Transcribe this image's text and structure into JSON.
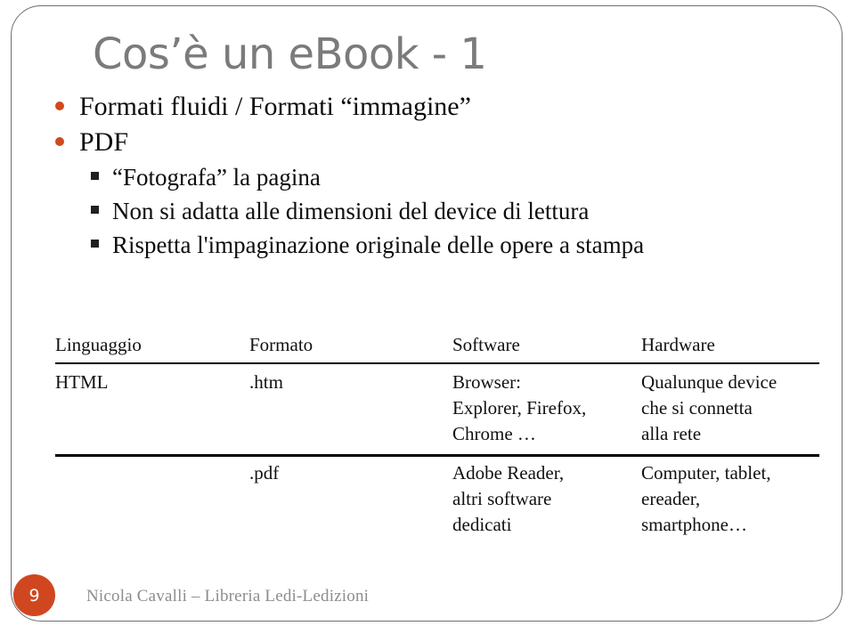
{
  "slide": {
    "title": "Cos’è un eBook - 1",
    "accent_color": "#d0471f",
    "title_color": "#7b7b7b",
    "footer_color": "#8d8d8d",
    "bullets": [
      {
        "level": 1,
        "marker": "dot",
        "text": "Formati fluidi / Formati “immagine”"
      },
      {
        "level": 1,
        "marker": "dot",
        "text": "PDF"
      },
      {
        "level": 2,
        "marker": "square",
        "text": "“Fotografa” la pagina"
      },
      {
        "level": 2,
        "marker": "square",
        "text": "Non si adatta alle dimensioni del device di lettura"
      },
      {
        "level": 2,
        "marker": "square",
        "text": "Rispetta l'impaginazione originale delle opere a stampa"
      }
    ],
    "table": {
      "headers": [
        "Linguaggio",
        "Formato",
        "Software",
        "Hardware"
      ],
      "rows": [
        {
          "linguaggio": "HTML",
          "formato": ".htm",
          "software": [
            "Browser:",
            "Explorer, Firefox,",
            "Chrome …"
          ],
          "hardware": [
            "Qualunque device",
            "che si connetta",
            "alla rete"
          ]
        },
        {
          "linguaggio": "",
          "formato": ".pdf",
          "software": [
            "Adobe Reader,",
            "altri software",
            "dedicati"
          ],
          "hardware": [
            "Computer, tablet,",
            "ereader,",
            "smartphone…"
          ]
        }
      ]
    },
    "footer": {
      "page_number": "9",
      "credit": "Nicola Cavalli – Libreria Ledi-Ledizioni"
    }
  }
}
